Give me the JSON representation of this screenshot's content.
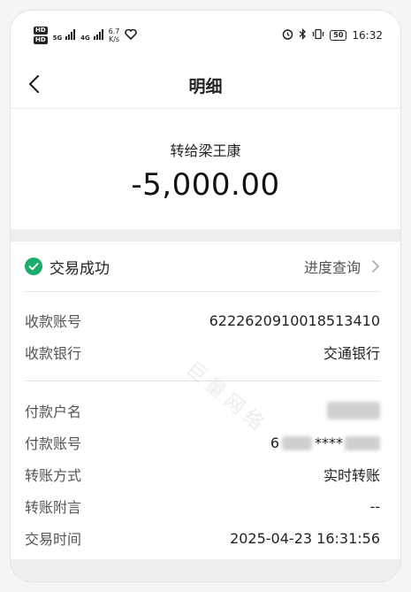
{
  "status_bar": {
    "hd1": "HD",
    "hd2": "HD",
    "net1": "5G",
    "net2": "4G",
    "speed_value": "6.7",
    "speed_unit": "K/s",
    "time": "16:32",
    "battery": "50"
  },
  "nav": {
    "title": "明细"
  },
  "summary": {
    "recipient": "转给梁王康",
    "amount": "-5,000.00"
  },
  "status": {
    "label": "交易成功",
    "link": "进度查询"
  },
  "receiver": {
    "rows": [
      {
        "label": "收款账号",
        "value": "6222620910018513410"
      },
      {
        "label": "收款银行",
        "value": "交通银行"
      }
    ]
  },
  "payer": {
    "rows": [
      {
        "label": "付款户名",
        "value": ""
      },
      {
        "label": "付款账号",
        "value_prefix": "6",
        "value_mask": "****"
      },
      {
        "label": "转账方式",
        "value": "实时转账"
      },
      {
        "label": "转账附言",
        "value": "--"
      },
      {
        "label": "交易时间",
        "value": "2025-04-23 16:31:56"
      }
    ]
  },
  "watermark": "巨量网络",
  "colors": {
    "success": "#1aad6b",
    "band": "#eeeeee"
  }
}
